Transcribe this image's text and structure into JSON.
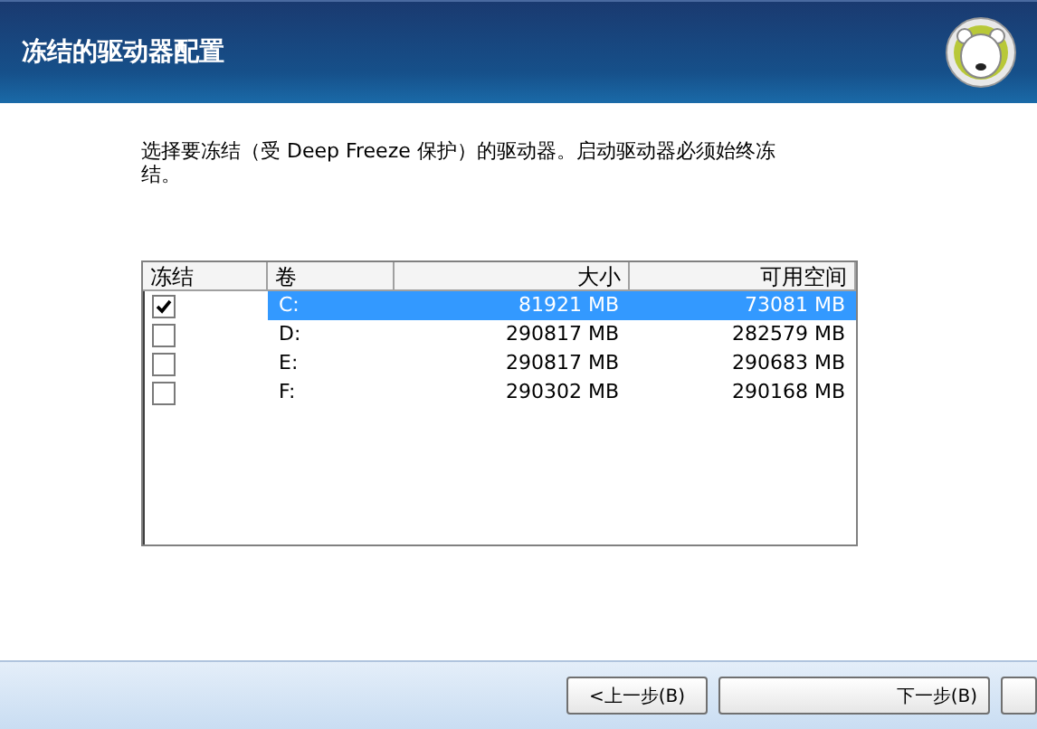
{
  "header": {
    "title": "冻结的驱动器配置"
  },
  "instruction": "选择要冻结（受 Deep Freeze 保护）的驱动器。启动驱动器必须始终冻结。",
  "table": {
    "columns": [
      "冻结",
      "卷",
      "大小",
      "可用空间"
    ],
    "rows": [
      {
        "checked": true,
        "selected": true,
        "volume": "C:",
        "size": "81921 MB",
        "free": "73081 MB"
      },
      {
        "checked": false,
        "selected": false,
        "volume": "D:",
        "size": "290817 MB",
        "free": "282579 MB"
      },
      {
        "checked": false,
        "selected": false,
        "volume": "E:",
        "size": "290817 MB",
        "free": "290683 MB"
      },
      {
        "checked": false,
        "selected": false,
        "volume": "F:",
        "size": "290302 MB",
        "free": "290168 MB"
      }
    ]
  },
  "buttons": [
    {
      "label": "<上一步(B)"
    },
    {
      "label": "下一步(B)"
    },
    {
      "cut_off": true
    }
  ]
}
